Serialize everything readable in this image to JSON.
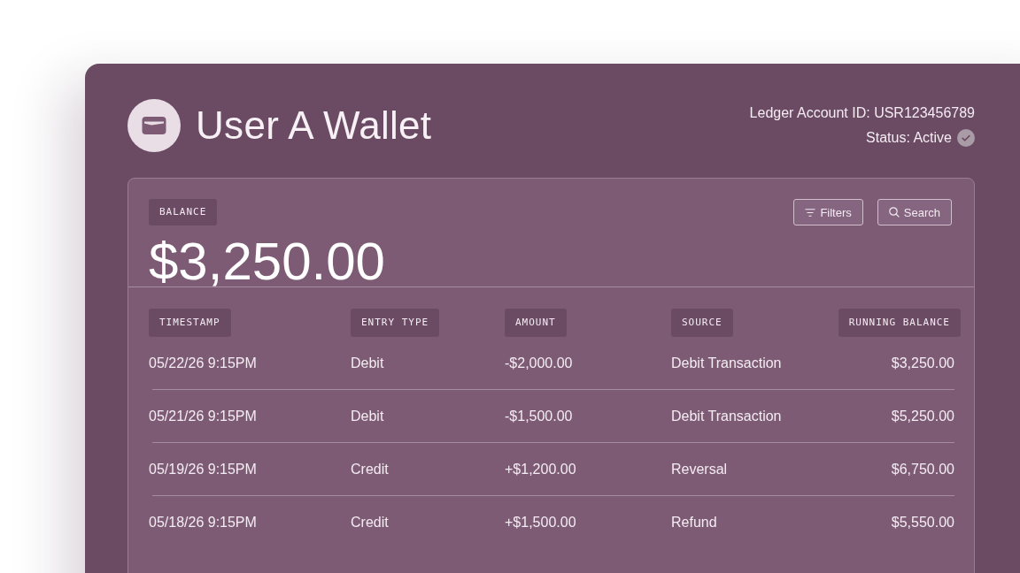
{
  "header": {
    "title": "User A Wallet",
    "account_id": "Ledger Account ID: USR123456789",
    "status": "Status: Active"
  },
  "balance": {
    "label": "BALANCE",
    "amount": "$3,250.00"
  },
  "toolbar": [
    {
      "label": "Filters",
      "kind": "filter"
    },
    {
      "label": "Search",
      "kind": "search"
    }
  ],
  "table": {
    "columns": [
      "TIMESTAMP",
      "ENTRY TYPE",
      "AMOUNT",
      "SOURCE",
      "RUNNING BALANCE"
    ],
    "rows": [
      [
        "05/22/26 9:15PM",
        "Debit",
        "-$2,000.00",
        "Debit Transaction",
        "$3,250.00"
      ],
      [
        "05/21/26 9:15PM",
        "Debit",
        "-$1,500.00",
        "Debit Transaction",
        "$5,250.00"
      ],
      [
        "05/19/26 9:15PM",
        "Credit",
        "+$1,200.00",
        "Reversal",
        "$6,750.00"
      ],
      [
        "05/18/26 9:15PM",
        "Credit",
        "+$1,500.00",
        "Refund",
        "$5,550.00"
      ]
    ]
  }
}
